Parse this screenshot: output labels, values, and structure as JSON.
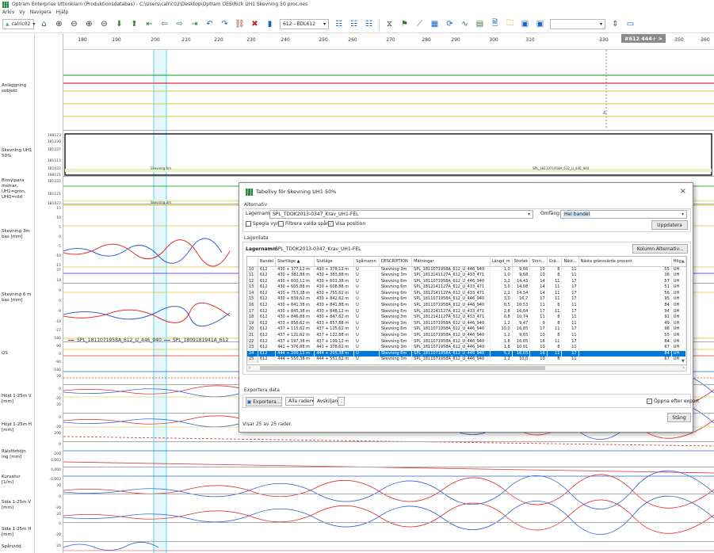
{
  "window": {
    "title": "Optram Enterprise Uttonkiarn (Produktionsdatabas) - C:\\Users\\calric02\\Desktop\\Optram OES\\Rick UH1 Skevning 50 proc.oes",
    "menu": [
      "Arkiv",
      "Vy",
      "Navigera",
      "Hjälp"
    ]
  },
  "toolbar": {
    "user": "calric02",
    "track": "612 - BDL612",
    "position_field": ""
  },
  "ruler": {
    "ticks": [
      "180",
      "190",
      "200",
      "210",
      "220",
      "230",
      "240",
      "250",
      "260",
      "270",
      "280",
      "290",
      "300",
      "310",
      "330",
      "340",
      "350",
      "360"
    ],
    "position_badge": "#612 444+ >"
  },
  "rows": [
    {
      "label": "Anläggning sobjekt"
    },
    {
      "label": "Skevning UH1 50%"
    },
    {
      "label": "Bissyipara metrar, UH1=grön, UHQ=röd"
    },
    {
      "label": "Skevning 3m bas [mm]"
    },
    {
      "label": "Skevning 6 m bas [mm]"
    },
    {
      "label": "QS"
    },
    {
      "label": "Höjd 1-25m V [mm]"
    },
    {
      "label": "Höjd 1-25m H [mm]"
    },
    {
      "label": "Rälsförhöjn ing [mm]"
    },
    {
      "label": "Kurvatur [1/m]"
    },
    {
      "label": "Sida 1-25m V [mm]"
    },
    {
      "label": "Sida 1-25m H [mm]"
    },
    {
      "label": "Spårvidd"
    }
  ],
  "axis_values": {
    "skevning": [
      "198123",
      "181230",
      "181227",
      "181113",
      "181022"
    ],
    "bissy": [
      "198121",
      "181222",
      "181121",
      "181022"
    ],
    "s3m": [
      "15",
      "10",
      "5",
      "0",
      "-5",
      "-10",
      "-15"
    ],
    "s6m": [
      "27",
      "18",
      "9",
      "0",
      "-9",
      "-18",
      "-27"
    ],
    "qs": [
      "180",
      "90",
      "0",
      "-90",
      "-180"
    ],
    "h1": [
      "20",
      "0",
      "-20"
    ],
    "h2": [
      "20",
      "0",
      "-20"
    ],
    "rals": [
      "200",
      "0",
      "-200"
    ],
    "kurv": [
      "0,003",
      "0,000",
      "-0,003"
    ],
    "s1": [
      "20",
      "0",
      "-20"
    ],
    "s2": [
      "20",
      "0",
      "-20"
    ],
    "spar": [
      "20"
    ]
  },
  "plot": {
    "skevning_label_left": "Skevning 6m",
    "skevning_label_right": "SPL_1811071958A_612_U_446_940",
    "bissy_label": "Skevning 3m",
    "legend1": "SPL_1811071958A_612_U_446_940",
    "legend2": "SPL_1809181941A_612",
    "legend_colors": [
      "#e03030",
      "#3060d0"
    ]
  },
  "dialog": {
    "title": "Tabellvy för Skevning UH1 50%",
    "close": "×",
    "alternativ_title": "Alternativ",
    "lagernamn_label": "Lagernamn:",
    "lagernamn_value": "SPL_TDOK2013-0347_Krav_UH1-FEL",
    "omfang_label": "Omfång:",
    "omfang_value": "Hel bandel",
    "chk_spegla": "Spegla vyn",
    "chk_filtrera": "Filtrera valda spår",
    "chk_visa": "Visa position",
    "uppdatera": "Uppdatera",
    "lagerdata_title": "Lagerdata",
    "lagernamn_bold": "Lagernamn:",
    "lagernamn_bold_value": "SPL_TDOK2013-0347_Krav_UH1-FEL",
    "kolumn_btn": "Kolumn Alternativ...",
    "columns": [
      "",
      "Bandel",
      "Startläge ▲",
      "Slutläge",
      "Spårnamn",
      "DESCRIPTION",
      "Mätningar",
      "Längd_m",
      "Storlek",
      "Stori...",
      "Grä...",
      "Näst...",
      "Nästa gränsvärde procent",
      "Hög"
    ],
    "rows": [
      [
        "10",
        "612",
        "430 + 377,12 m",
        "430 + 378,12 m",
        "U",
        "Skevning 3m",
        "SPL_1811071958A_612_U_446_940",
        "1,0",
        "9,66",
        "10",
        "8",
        "11",
        "55",
        "UH"
      ],
      [
        "11",
        "612",
        "430 + 382,88 m",
        "430 + 383,88 m",
        "U",
        "Skevning 3m",
        "SPL_1812141127A_612_U_433_471",
        "1,0",
        "9,68",
        "10",
        "8",
        "11",
        "36",
        "UH"
      ],
      [
        "12",
        "612",
        "430 + 600,12 m",
        "430 + 603,38 m",
        "U",
        "Skevning 6m",
        "SPL_1811071958A_612_U_446_940",
        "3,2",
        "14,43",
        "14",
        "11",
        "17",
        "57",
        "UH"
      ],
      [
        "13",
        "612",
        "430 + 605,88 m",
        "430 + 608,88 m",
        "U",
        "Skevning 6m",
        "SPL_1812141127A_612_U_433_471",
        "3,0",
        "14,08",
        "14",
        "11",
        "17",
        "51",
        "UH"
      ],
      [
        "14",
        "612",
        "430 + 753,38 m",
        "430 + 755,62 m",
        "U",
        "Skevning 6m",
        "SPL_1812141127A_612_U_433_471",
        "2,2",
        "14,54",
        "14",
        "11",
        "17",
        "56",
        "UH"
      ],
      [
        "15",
        "612",
        "430 + 839,62 m",
        "430 + 842,62 m",
        "U",
        "Skevning 6m",
        "SPL_1811071958A_612_U_446_940",
        "3,0",
        "16,7",
        "17",
        "11",
        "17",
        "95",
        "UH"
      ],
      [
        "16",
        "612",
        "430 + 841,38 m",
        "430 + 841,88 m",
        "U",
        "Skevning 6m",
        "SPL_1811071958A_612_U_446_940",
        "0,5",
        "10,53",
        "11",
        "8",
        "11",
        "84",
        "UH"
      ],
      [
        "17",
        "612",
        "430 + 845,38 m",
        "430 + 848,12 m",
        "U",
        "Skevning 6m",
        "SPL_1812141127A_612_U_433_471",
        "2,8",
        "16,64",
        "17",
        "11",
        "17",
        "94",
        "UH"
      ],
      [
        "18",
        "612",
        "430 + 846,88 m",
        "430 + 847,62 m",
        "U",
        "Skevning 3m",
        "SPL_1812141127A_612_U_433_471",
        "0,8",
        "10,74",
        "11",
        "8",
        "11",
        "91",
        "UH"
      ],
      [
        "19",
        "612",
        "433 + 856,62 m",
        "433 + 857,88 m",
        "U",
        "Skevning 3m",
        "SPL_1811071958A_612_U_446_940",
        "1,2",
        "9,47",
        "9",
        "8",
        "11",
        "49",
        "UH"
      ],
      [
        "20",
        "612",
        "437 + 115,62 m",
        "437 + 125,62 m",
        "U",
        "Skevning 6m",
        "SPL_1811071958A_612_U_446_940",
        "10,0",
        "16,85",
        "17",
        "11",
        "17",
        "98",
        "UH"
      ],
      [
        "21",
        "612",
        "437 + 121,62 m",
        "437 + 122,88 m",
        "U",
        "Skevning 3m",
        "SPL_1811071958A_612_U_446_940",
        "1,2",
        "9,65",
        "10",
        "8",
        "11",
        "55",
        "UH"
      ],
      [
        "22",
        "612",
        "437 + 197,38 m",
        "437 + 199,12 m",
        "U",
        "Skevning 6m",
        "SPL_1811071958A_612_U_446_940",
        "1,8",
        "16,05",
        "16",
        "11",
        "17",
        "84",
        "UH"
      ],
      [
        "23",
        "612",
        "441 + 376,88 m",
        "441 + 378,62 m",
        "U",
        "Skevning 3m",
        "SPL_1811071958A_612_U_446_940",
        "1,8",
        "10,01",
        "10",
        "8",
        "11",
        "67",
        "UH"
      ],
      [
        "24",
        "612",
        "444 + 200,12 m",
        "444 + 205,38 m",
        "U",
        "Skevning 6m",
        "SPL_1811071958A_612_U_446_940",
        "5,2",
        "16,03",
        "16",
        "11",
        "17",
        "84",
        "UH"
      ],
      [
        "25",
        "612",
        "444 + 550,38 m",
        "444 + 551,62 m",
        "U",
        "Skevning 3m",
        "SPL_1811071958A_612_U_446_940",
        "1,2",
        "10,0",
        "10",
        "8",
        "11",
        "67",
        "UH"
      ]
    ],
    "selected_row": "24",
    "export_title": "Exportera data",
    "export_btn": "Exportera...",
    "alla_rader": "Alla rader",
    "avskiljare_label": "Avskiljare",
    "avskiljare_value": ";",
    "oppna_label": "Öppna efter export",
    "stang": "Stäng",
    "status": "Visar 25 av 25 rader."
  }
}
